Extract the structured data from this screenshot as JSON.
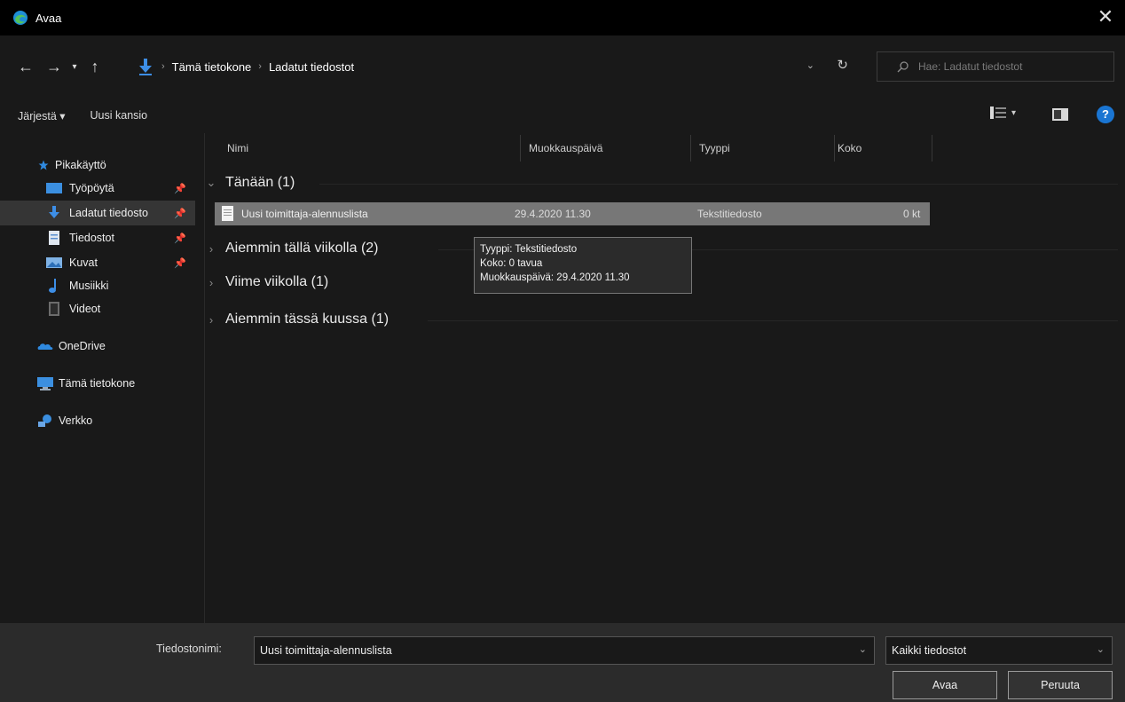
{
  "window": {
    "title": "Avaa",
    "app_icon": "edge-browser-icon",
    "close_icon": "close-icon"
  },
  "navigation": {
    "back_icon": "arrow-left-icon",
    "forward_icon": "arrow-right-icon",
    "recent_icon": "chevron-down-icon",
    "up_icon": "arrow-up-icon",
    "breadcrumbs": [
      "Tämä tietokone",
      "Ladatut tiedostot"
    ],
    "refresh_icon": "refresh-icon"
  },
  "search": {
    "placeholder": "Hae: Ladatut tiedostot"
  },
  "toolbar": {
    "organize_label": "Järjestä ▾",
    "new_folder_label": "Uusi kansio",
    "help_label": "?"
  },
  "sidebar": {
    "items": [
      {
        "label": "Pikakäyttö",
        "icon": "star-icon"
      },
      {
        "label": "Työpöytä",
        "icon": "desktop-icon",
        "pinned": true
      },
      {
        "label": "Ladatut tiedosto",
        "icon": "download-icon",
        "pinned": true,
        "selected": true
      },
      {
        "label": "Tiedostot",
        "icon": "document-icon",
        "pinned": true
      },
      {
        "label": "Kuvat",
        "icon": "pictures-icon",
        "pinned": true
      },
      {
        "label": "Musiikki",
        "icon": "music-icon"
      },
      {
        "label": "Videot",
        "icon": "video-icon"
      },
      {
        "label": "OneDrive",
        "icon": "cloud-icon"
      },
      {
        "label": "Tämä tietokone",
        "icon": "computer-icon"
      },
      {
        "label": "Verkko",
        "icon": "network-icon"
      }
    ]
  },
  "columns": [
    "Nimi",
    "Muokkauspäivä",
    "Tyyppi",
    "Koko"
  ],
  "groups": [
    {
      "label": "Tänään (1)",
      "expanded": true
    },
    {
      "label": "Aiemmin tällä viikolla (2)",
      "expanded": false
    },
    {
      "label": "Viime viikolla (1)",
      "expanded": false
    },
    {
      "label": "Aiemmin tässä kuussa (1)",
      "expanded": false
    }
  ],
  "files": [
    {
      "name": "Uusi toimittaja-alennuslista",
      "modified": "29.4.2020 11.30",
      "type": "Tekstitiedosto",
      "size": "0 kt",
      "selected": true
    }
  ],
  "tooltip": {
    "lines": [
      "Tyyppi: Tekstitiedosto",
      "Koko: 0 tavua",
      "Muokkauspäivä: 29.4.2020 11.30"
    ]
  },
  "footer": {
    "filename_label": "Tiedostonimi:",
    "filename_value": "Uusi toimittaja-alennuslista",
    "filetype_value": "Kaikki tiedostot",
    "open_label": "Avaa",
    "cancel_label": "Peruuta"
  },
  "colors": {
    "accent": "#1a75d2",
    "window_bg": "#191919",
    "selected_row": "#777777"
  }
}
